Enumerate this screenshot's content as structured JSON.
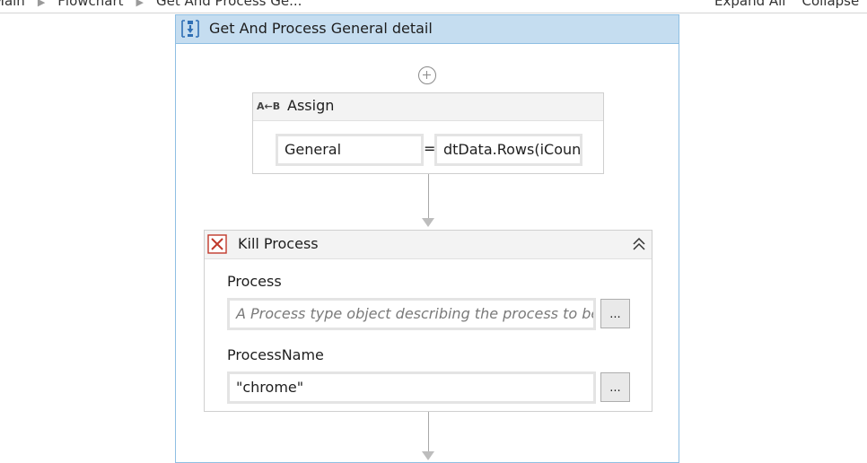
{
  "breadcrumb": {
    "items": [
      "Main",
      "Flowchart",
      "Get And Process Ge..."
    ],
    "actions": [
      "Expand All",
      "Collapse"
    ]
  },
  "sequence": {
    "title": "Get And Process General detail"
  },
  "assign": {
    "title": "Assign",
    "icon_label": "A←B",
    "to_value": "General",
    "equals": "=",
    "value": "dtData.Rows(iCount"
  },
  "kill_process": {
    "title": "Kill Process",
    "process_label": "Process",
    "process_placeholder": "A Process type object describing the process to be closed",
    "process_name_label": "ProcessName",
    "process_name_value": "\"chrome\"",
    "browse_label": "..."
  },
  "colors": {
    "sequence_header": "#c5ddf0",
    "sequence_border": "#8fbfe3",
    "activity_header": "#f3f3f3",
    "kill_icon": "#c0392b",
    "sequence_icon": "#2f6fb5"
  },
  "icons": {
    "sequence": "sequence-icon",
    "add": "plus-circle-icon",
    "assign": "assign-icon",
    "kill": "kill-process-icon",
    "collapse": "double-chevron-up-icon"
  }
}
